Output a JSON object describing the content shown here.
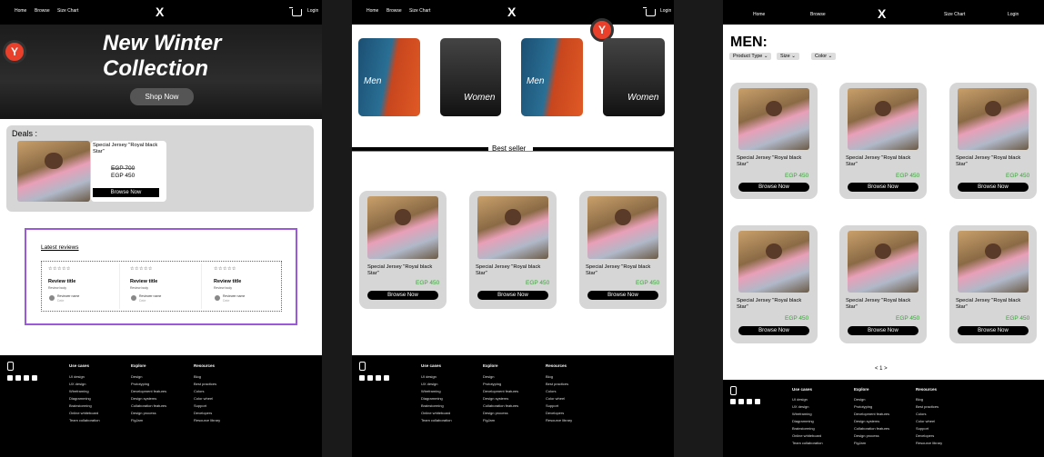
{
  "nav": {
    "home": "Home",
    "browse": "Browse",
    "size_chart": "Size Chart",
    "logo": "X",
    "login": "Login"
  },
  "hero": {
    "title_line1": "New Winter",
    "title_line2": "Collection",
    "cta": "Shop Now"
  },
  "deals": {
    "heading": "Deals :",
    "product": "Special Jersey \"Royal black Star\"",
    "old_price": "EGP 700",
    "new_price": "EGP 450",
    "button": "Browse Now"
  },
  "reviews": {
    "heading": "Latest reviews",
    "items": [
      {
        "stars": "☆☆☆☆☆",
        "title": "Review title",
        "body": "Review body",
        "name": "Reviewer name",
        "date": "Date"
      },
      {
        "stars": "☆☆☆☆☆",
        "title": "Review title",
        "body": "Review body",
        "name": "Reviewer name",
        "date": "Date"
      },
      {
        "stars": "☆☆☆☆☆",
        "title": "Review title",
        "body": "Review body",
        "name": "Reviewer name",
        "date": "Date"
      }
    ]
  },
  "categories": [
    "Men",
    "Women",
    "Men",
    "Women"
  ],
  "best_seller": "Best seller",
  "product": {
    "title": "Special Jersey \"Royal black Star\"",
    "price": "EGP 450",
    "button": "Browse Now"
  },
  "men_page": {
    "heading": "MEN:",
    "filters": [
      "Product Type",
      "Size",
      "Color"
    ],
    "pagination": "< 1 >"
  },
  "badge": "Y",
  "footer": {
    "use_cases": {
      "title": "Use cases",
      "links": [
        "UI design",
        "UX design",
        "Wireframing",
        "Diagramming",
        "Brainstorming",
        "Online whiteboard",
        "Team collaboration"
      ]
    },
    "explore": {
      "title": "Explore",
      "links": [
        "Design",
        "Prototyping",
        "Development features",
        "Design systems",
        "Collaboration features",
        "Design process",
        "FigJam"
      ]
    },
    "resources": {
      "title": "Resources",
      "links": [
        "Blog",
        "Best practices",
        "Colors",
        "Color wheel",
        "Support",
        "Developers",
        "Resource library"
      ]
    }
  },
  "colors": {
    "accent_green": "#3aa33a",
    "badge_red": "#e8402a",
    "review_border": "#9b59d9"
  }
}
